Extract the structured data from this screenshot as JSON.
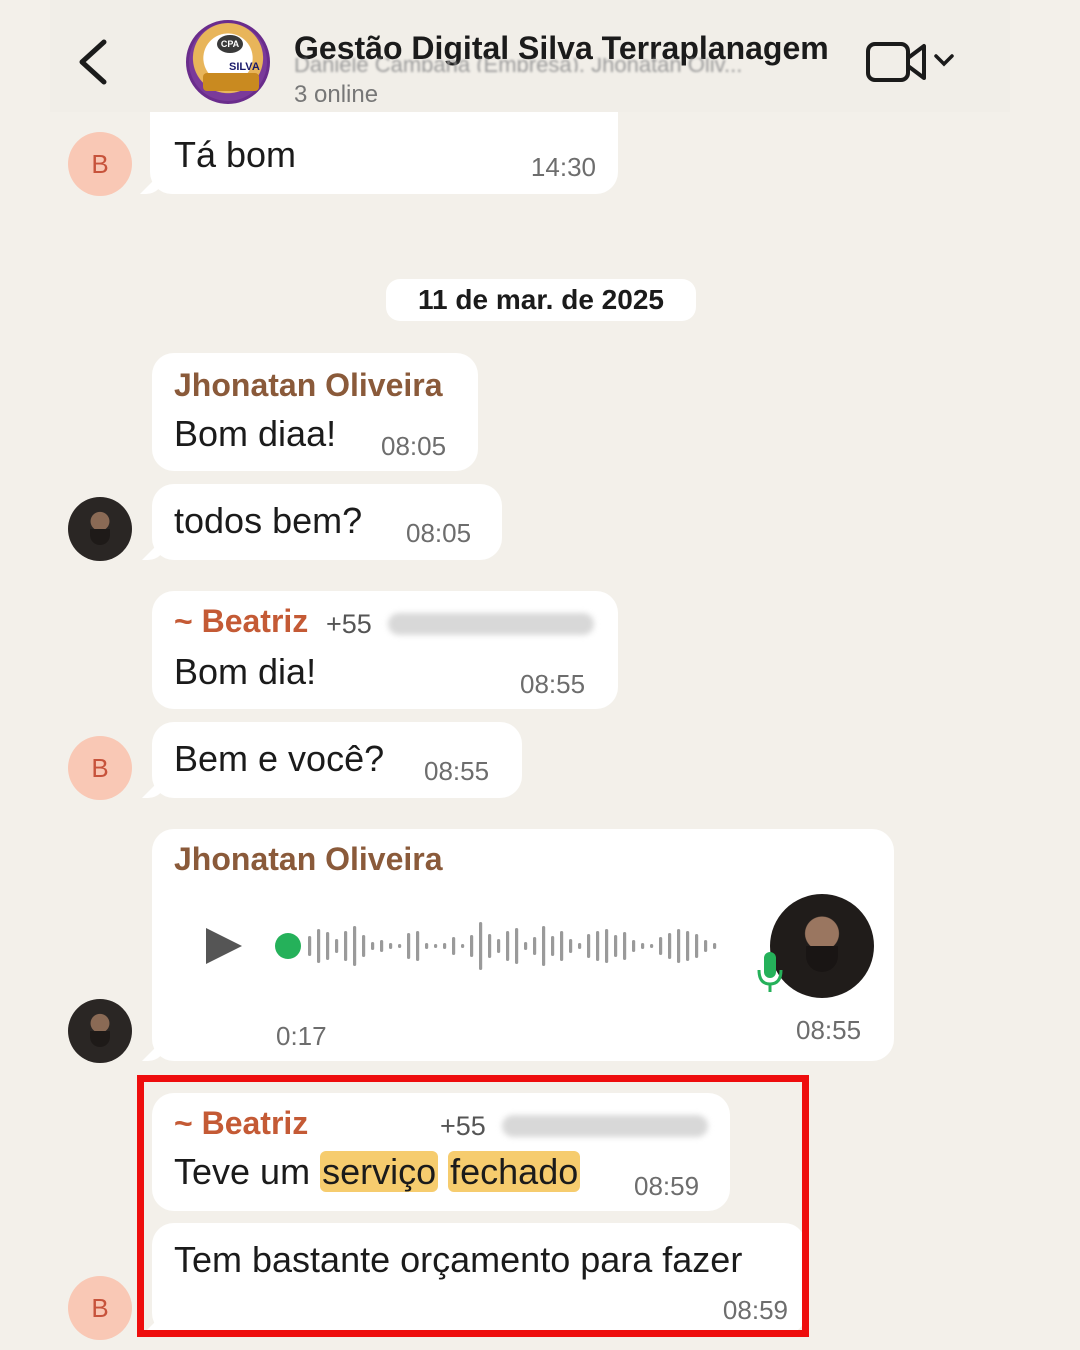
{
  "header": {
    "back_label": "<",
    "title": "Gestão Digital Silva Terraplanagem",
    "members_preview": "Daniele Campana (Empresa), Jhonatan Oliv...",
    "online": "3 online",
    "avatar_text_top": "CPA",
    "avatar_text_bottom": "SILVA"
  },
  "messages": {
    "m0": {
      "avatar_letter": "B",
      "text": "Tá bom",
      "time": "14:30"
    },
    "date_separator": "11 de mar. de 2025",
    "m1": {
      "sender": "Jhonatan Oliveira",
      "text": "Bom diaa!",
      "time": "08:05"
    },
    "m2": {
      "text": "todos bem?",
      "time": "08:05"
    },
    "m3": {
      "sender": "~ Beatriz",
      "phone": "+55",
      "text": "Bom dia!",
      "time": "08:55"
    },
    "m4": {
      "avatar_letter": "B",
      "text": "Bem e você?",
      "time": "08:55"
    },
    "m5": {
      "sender": "Jhonatan Oliveira",
      "duration": "0:17",
      "time": "08:55"
    },
    "m6": {
      "sender": "~ Beatriz",
      "phone": "+55",
      "text_before": "Teve um",
      "text_hl1": "serviço",
      "text_hl2": "fechado",
      "time": "08:59"
    },
    "m7": {
      "avatar_letter": "B",
      "text": "Tem bastante orçamento para fazer",
      "time": "08:59"
    }
  },
  "colors": {
    "background": "#f3f0ea",
    "bubble": "#ffffff",
    "highlight": "#f6cc6e",
    "frame": "#ee0d0d",
    "voice_dot": "#25b15a"
  },
  "icons": [
    "back-arrow-icon",
    "video-call-icon",
    "chevron-down-icon",
    "play-icon",
    "waveform-icon",
    "microphone-icon"
  ]
}
